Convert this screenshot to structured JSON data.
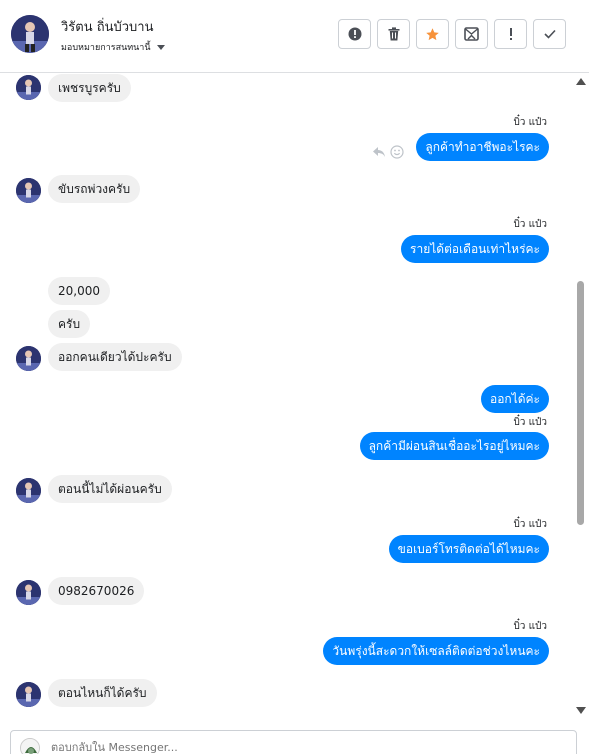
{
  "header": {
    "contact_name": "วิรัตน ถิ่นบัวบาน",
    "assign_label": "มอบหมายการสนทนานี้",
    "toolbar": [
      {
        "name": "report-spam-button",
        "icon": "alert-circle-icon"
      },
      {
        "name": "delete-button",
        "icon": "trash-icon"
      },
      {
        "name": "star-button",
        "icon": "star-icon"
      },
      {
        "name": "mark-unread-button",
        "icon": "envelope-x-icon"
      },
      {
        "name": "follow-up-button",
        "icon": "exclamation-icon"
      },
      {
        "name": "mark-done-button",
        "icon": "checkmark-icon"
      }
    ],
    "accent_star": "#f7923a"
  },
  "messages": {
    "m1": "เพชรบูรครับ",
    "s2": "บิ๋ว แป๋ว",
    "m2": "ลูกค้าทำอาชีพอะไรคะ",
    "m3": "ขับรถพ่วงครับ",
    "s4": "บิ๋ว แป๋ว",
    "m4": "รายได้ต่อเดือนเท่าไหร่คะ",
    "m5": "20,000",
    "m6": "ครับ",
    "m7": "ออกคนเดียวได้ปะครับ",
    "m8": "ออกได้ค่ะ",
    "s9": "บิ๋ว แป๋ว",
    "m9": "ลูกค้ามีผ่อนสินเชื่ออะไรอยู่ไหมคะ",
    "m10": "ตอนนี้ไม่ได้ผ่อนครับ",
    "s11": "บิ๋ว แป๋ว",
    "m11": "ขอเบอร์โทรติดต่อได้ไหมคะ",
    "m12": "0982670026",
    "s13": "บิ๋ว แป๋ว",
    "m13": "วันพรุ่งนี้สะดวกให้เซลล์ติดต่อช่วงไหนคะ",
    "m14": "ตอนไหนก็ได้ครับ"
  },
  "composer": {
    "placeholder": "ตอบกลับใน Messenger..."
  },
  "colors": {
    "outgoing_bubble": "#0084ff",
    "incoming_bubble": "#f0f0f0"
  }
}
